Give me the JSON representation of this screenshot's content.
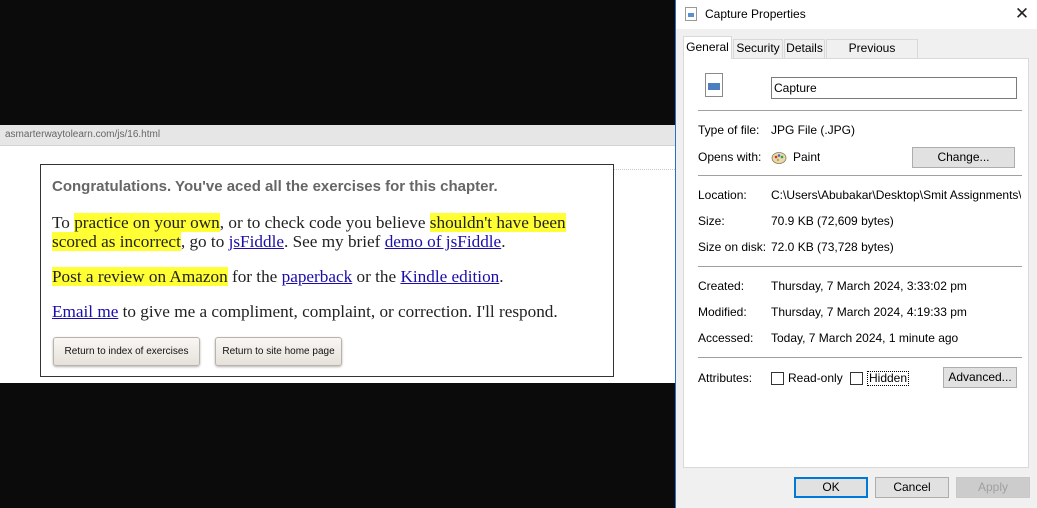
{
  "browser": {
    "url": "asmarterwaytolearn.com/js/16.html",
    "congrats": "Congratulations. You've aced all the exercises for this chapter.",
    "p1": {
      "t1": "To ",
      "hl1": "practice on your own",
      "t2": ", or to check code you believe ",
      "hl2a": "shouldn't have been",
      "hl2b": "scored as incorrect",
      "t3": ", go to ",
      "link1": "jsFiddle",
      "t4": ". See my brief ",
      "link2": "demo of jsFiddle",
      "t5": "."
    },
    "p2": {
      "hl": "Post a review on Amazon",
      "t1": " for the ",
      "link1": "paperback",
      "t2": " or the ",
      "link2": "Kindle edition",
      "t3": "."
    },
    "p3": {
      "link": "Email me",
      "t1": " to give me a compliment, complaint, or correction. I'll respond."
    },
    "buttons": {
      "index": "Return to index of exercises",
      "home": "Return to site home page"
    }
  },
  "dialog": {
    "title": "Capture Properties",
    "tabs": [
      "General",
      "Security",
      "Details",
      "Previous Versions"
    ],
    "name_value": "Capture",
    "rows": {
      "type_label": "Type of file:",
      "type_value": "JPG File (.JPG)",
      "opens_label": "Opens with:",
      "opens_value": "Paint",
      "change": "Change...",
      "location_label": "Location:",
      "location_value": "C:\\Users\\Abubakar\\Desktop\\Smit Assignments\\Ass",
      "size_label": "Size:",
      "size_value": "70.9 KB (72,609 bytes)",
      "disk_label": "Size on disk:",
      "disk_value": "72.0 KB (73,728 bytes)",
      "created_label": "Created:",
      "created_value": "Thursday, 7 March 2024, 3:33:02 pm",
      "modified_label": "Modified:",
      "modified_value": "Thursday, 7 March 2024, 4:19:33 pm",
      "accessed_label": "Accessed:",
      "accessed_value": "Today, 7 March 2024, 1 minute ago",
      "attributes_label": "Attributes:",
      "readonly": "Read-only",
      "hidden": "Hidden",
      "advanced": "Advanced..."
    },
    "footer": {
      "ok": "OK",
      "cancel": "Cancel",
      "apply": "Apply"
    }
  },
  "colors": {
    "highlight": "#ffff33",
    "link": "#1a0dab",
    "dialog_accent": "#0078d7"
  }
}
